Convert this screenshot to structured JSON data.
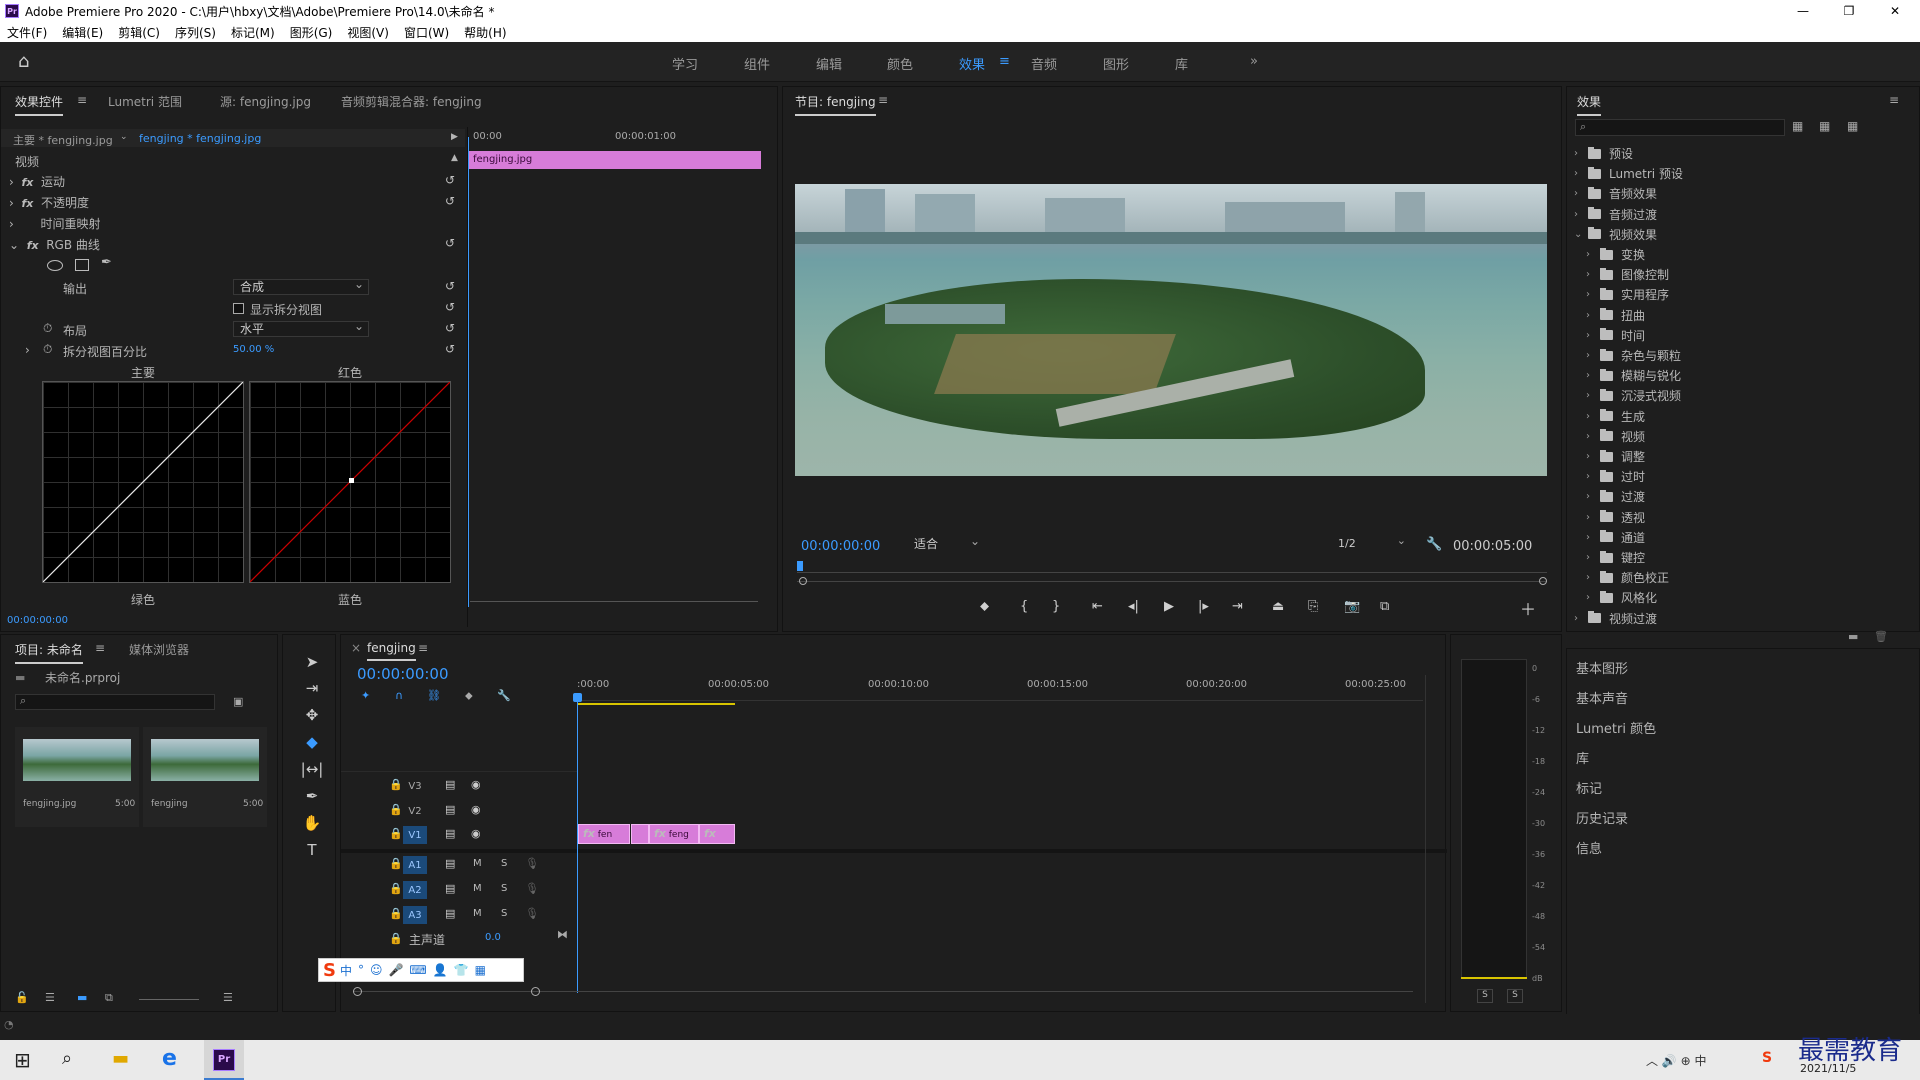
{
  "app": {
    "title": "Adobe Premiere Pro 2020 - C:\\用户\\hbxy\\文档\\Adobe\\Premiere Pro\\14.0\\未命名 *",
    "logo": "Pr"
  },
  "menu": [
    "文件(F)",
    "编辑(E)",
    "剪辑(C)",
    "序列(S)",
    "标记(M)",
    "图形(G)",
    "视图(V)",
    "窗口(W)",
    "帮助(H)"
  ],
  "workspaces": [
    "学习",
    "组件",
    "编辑",
    "颜色",
    "效果",
    "音频",
    "图形",
    "库"
  ],
  "effectControls": {
    "tabs": [
      "效果控件",
      "Lumetri 范围",
      "源: fengjing.jpg",
      "音频剪辑混合器: fengjing"
    ],
    "master": "主要 * fengjing.jpg",
    "clip": "fengjing * fengjing.jpg",
    "ruler": [
      "00:00",
      "00:00:01:00"
    ],
    "clipName": "fengjing.jpg",
    "section": "视频",
    "motion": "运动",
    "opacity": "不透明度",
    "timeRemap": "时间重映射",
    "rgbCurves": "RGB 曲线",
    "outputLabel": "输出",
    "outputValue": "合成",
    "splitView": "显示拆分视图",
    "layoutLabel": "布局",
    "layoutValue": "水平",
    "splitPercentLabel": "拆分视图百分比",
    "splitPercentValue": "50.00 %",
    "curveLabels": [
      "主要",
      "红色",
      "绿色",
      "蓝色"
    ],
    "timecode": "00:00:00:00",
    "fxLabel": "fx"
  },
  "program": {
    "title": "节目: fengjing",
    "timecode": "00:00:00:00",
    "fit": "适合",
    "quality": "1/2",
    "duration": "00:00:05:00"
  },
  "effects": {
    "title": "效果",
    "items": [
      {
        "label": "预设",
        "level": 0,
        "open": false
      },
      {
        "label": "Lumetri 预设",
        "level": 0,
        "open": false
      },
      {
        "label": "音频效果",
        "level": 0,
        "open": false
      },
      {
        "label": "音频过渡",
        "level": 0,
        "open": false
      },
      {
        "label": "视频效果",
        "level": 0,
        "open": true
      },
      {
        "label": "变换",
        "level": 1
      },
      {
        "label": "图像控制",
        "level": 1
      },
      {
        "label": "实用程序",
        "level": 1
      },
      {
        "label": "扭曲",
        "level": 1
      },
      {
        "label": "时间",
        "level": 1
      },
      {
        "label": "杂色与颗粒",
        "level": 1
      },
      {
        "label": "模糊与锐化",
        "level": 1
      },
      {
        "label": "沉浸式视频",
        "level": 1
      },
      {
        "label": "生成",
        "level": 1
      },
      {
        "label": "视频",
        "level": 1
      },
      {
        "label": "调整",
        "level": 1
      },
      {
        "label": "过时",
        "level": 1
      },
      {
        "label": "过渡",
        "level": 1
      },
      {
        "label": "透视",
        "level": 1
      },
      {
        "label": "通道",
        "level": 1
      },
      {
        "label": "键控",
        "level": 1
      },
      {
        "label": "颜色校正",
        "level": 1
      },
      {
        "label": "风格化",
        "level": 1
      },
      {
        "label": "视频过渡",
        "level": 0,
        "open": false
      }
    ],
    "sidePanels": [
      "基本图形",
      "基本声音",
      "Lumetri 颜色",
      "库",
      "标记",
      "历史记录",
      "信息"
    ]
  },
  "project": {
    "tabs": [
      "项目: 未命名",
      "媒体浏览器"
    ],
    "file": "未命名.prproj",
    "thumbs": [
      {
        "name": "fengjing.jpg",
        "dur": "5:00"
      },
      {
        "name": "fengjing",
        "dur": "5:00"
      }
    ]
  },
  "timeline": {
    "tab": "fengjing",
    "timecode": "00:00:00:00",
    "ruler": [
      ":00:00",
      "00:00:05:00",
      "00:00:10:00",
      "00:00:15:00",
      "00:00:20:00",
      "00:00:25:00"
    ],
    "videoTracks": [
      "V3",
      "V2",
      "V1"
    ],
    "audioTracks": [
      "A1",
      "A2",
      "A3"
    ],
    "master": "主声道",
    "masterValue": "0.0",
    "clips": [
      {
        "label": "fen"
      },
      {
        "label": ""
      },
      {
        "label": "feng"
      },
      {
        "label": ""
      }
    ],
    "fx": "fx",
    "m": "M",
    "s": "S"
  },
  "meter": {
    "labels": [
      "0",
      "-6",
      "-12",
      "-18",
      "-24",
      "-30",
      "-36",
      "-42",
      "-48",
      "-54",
      "dB"
    ],
    "solo": [
      "S",
      "S"
    ]
  },
  "ime": {
    "label": "中"
  },
  "tray": {
    "date": "2021/11/5",
    "watermark": "最需教育"
  }
}
